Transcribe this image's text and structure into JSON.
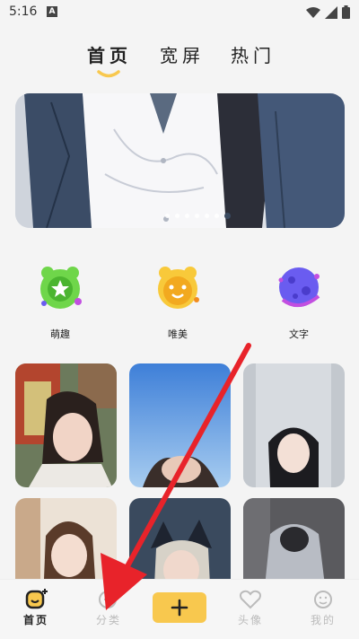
{
  "status_bar": {
    "time": "5:16",
    "notification_icon": "A"
  },
  "tabs": [
    {
      "label": "首页",
      "active": true
    },
    {
      "label": "宽屏",
      "active": false
    },
    {
      "label": "热门",
      "active": false
    }
  ],
  "banner": {
    "dot_count": 7,
    "active_dot": 6
  },
  "categories": [
    {
      "label": "萌趣",
      "icon": "green-star-cat-icon",
      "color": "#6fd64a"
    },
    {
      "label": "唯美",
      "icon": "yellow-bear-icon",
      "color": "#f8c93a"
    },
    {
      "label": "文字",
      "icon": "purple-planet-icon",
      "color": "#6a5cf0"
    }
  ],
  "bottom_nav": [
    {
      "label": "首页",
      "icon": "home-face-icon",
      "active": true
    },
    {
      "label": "分类",
      "icon": "category-plus-icon",
      "active": false
    },
    {
      "label": "",
      "icon": "add-icon",
      "active": false
    },
    {
      "label": "头像",
      "icon": "avatar-heart-icon",
      "active": false
    },
    {
      "label": "我的",
      "icon": "profile-icon",
      "active": false
    }
  ],
  "colors": {
    "accent": "#f8c84e",
    "arrow": "#e8232a"
  }
}
